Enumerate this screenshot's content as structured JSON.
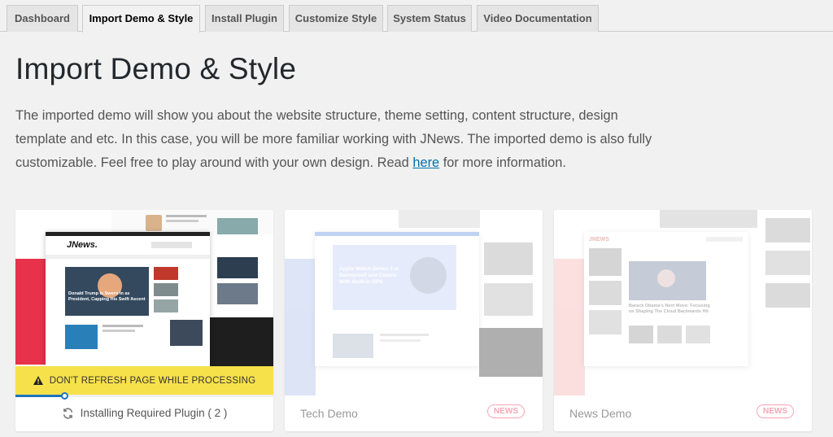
{
  "tabs": [
    {
      "label": "Dashboard",
      "active": false
    },
    {
      "label": "Import Demo & Style",
      "active": true
    },
    {
      "label": "Install Plugin",
      "active": false
    },
    {
      "label": "Customize Style",
      "active": false
    },
    {
      "label": "System Status",
      "active": false
    },
    {
      "label": "Video Documentation",
      "active": false
    }
  ],
  "page": {
    "title": "Import Demo & Style",
    "intro_before_link": "The imported demo will show you about the website structure, theme setting, content structure, design template and etc. In this case, you will be more familiar working with JNews. The imported demo is also fully customizable. Feel free to play around with your own design. Read ",
    "intro_link": "here",
    "intro_after_link": " for more information."
  },
  "cards": [
    {
      "thumb_brand": "JNews.",
      "thumb_headline": "Donald Trump Is Sworn In as President, Capping His Swift Ascent",
      "warning": "DON'T REFRESH PAGE WHILE PROCESSING",
      "progress": 0.19,
      "status": "Installing Required Plugin ( 2 )",
      "status_icon": "refresh-icon"
    },
    {
      "name": "Tech Demo",
      "badge": "NEWS",
      "thumb_headline": "Apple Watch Series 3 is Swimproof and Comes With Built-in GPS"
    },
    {
      "name": "News Demo",
      "badge": "NEWS",
      "thumb_brand": "JNEWS",
      "thumb_headline": "Barack Obama's Next Move: Focusing on Shaping The Cloud Backwards Hit"
    }
  ],
  "colors": {
    "accent_blue": "#1e73be",
    "warning_yellow": "#f7e14b",
    "badge_pink": "#f25c7a",
    "jnews_red": "#e8314a"
  }
}
